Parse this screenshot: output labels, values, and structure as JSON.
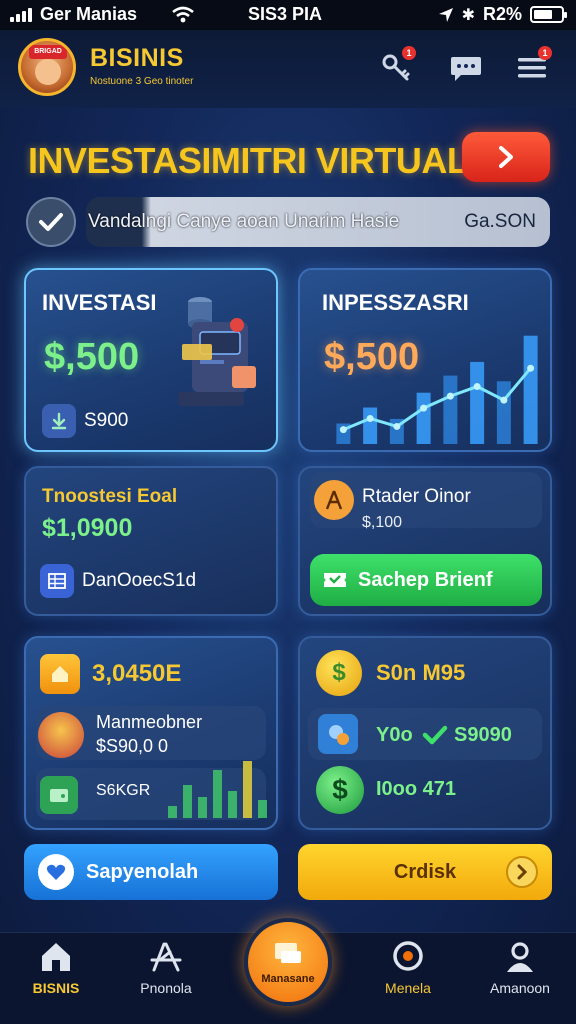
{
  "status_bar": {
    "carrier": "Ger Manias",
    "time": "SIS3 PIA",
    "battery": "R2%"
  },
  "header": {
    "app_name": "BISINIS",
    "tagline": "Nostuone 3 Geo tinoter",
    "avatar_badge": "BRIGAD",
    "notification_count": "1"
  },
  "title": {
    "text": "INVESTASIMITRI VIRTUAL"
  },
  "search": {
    "text": "Vandalngi Canye aoan Unarim Hasie",
    "amount": "Ga.SON"
  },
  "cards": {
    "investasi": {
      "label": "INVESTASI",
      "value": "$,500",
      "sub": "S900"
    },
    "inpesszasri": {
      "label": "INPESSZASRI",
      "value": "$,500",
      "chart_bars": [
        0.18,
        0.32,
        0.22,
        0.45,
        0.6,
        0.72,
        0.55,
        0.95
      ]
    },
    "total": {
      "label": "Tnoostesi Eoal",
      "value": "$1,0900",
      "action": "DanOoecS1d"
    },
    "trader": {
      "label": "Rtader Oinor",
      "value": "$,100",
      "button": "Sachep Brienf"
    },
    "stats_left": {
      "value": "3,0450E",
      "item1_title": "Manmeobner",
      "item1_value": "$S90,0 0",
      "item2_value": "S6KGR"
    },
    "stats_right": {
      "row1": "S0n M95",
      "row2_a": "Y0o",
      "row2_b": "S9090",
      "row3": "I0oo 471"
    }
  },
  "buttons": {
    "blue": "Sapyenolah",
    "yellow": "Crdisk"
  },
  "nav": {
    "home": "BISNIS",
    "portfolio": "Pnonola",
    "center": "Manasane",
    "menu": "Menela",
    "profile": "Amanoon"
  },
  "colors": {
    "accent_yellow": "#f6c832",
    "accent_green": "#7cf08a",
    "accent_orange": "#ffa95a",
    "danger": "#e8322e"
  }
}
